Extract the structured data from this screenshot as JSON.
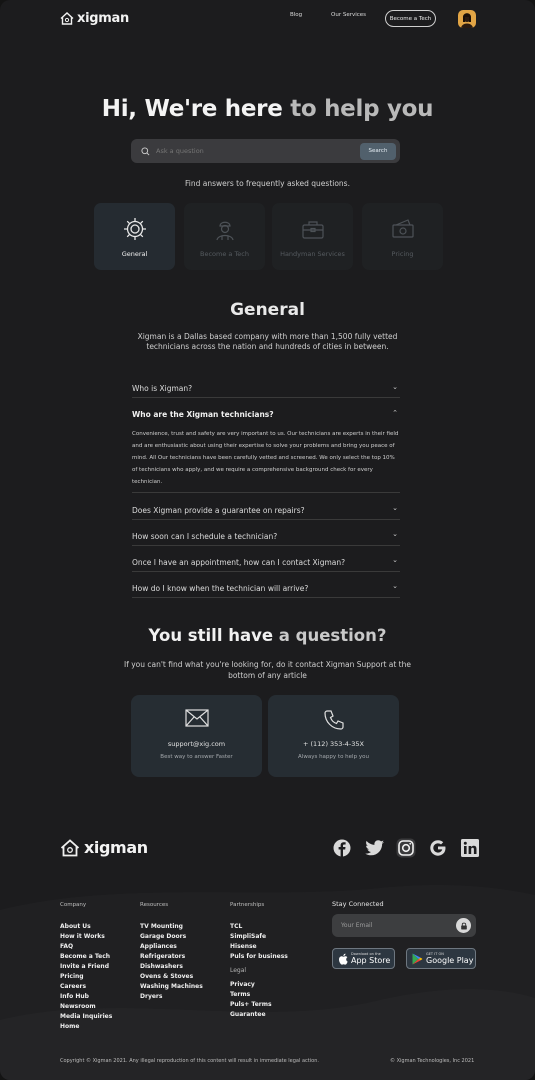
{
  "header": {
    "logo_text": "xigman",
    "nav": {
      "blog": "Blog",
      "services": "Our Services",
      "become": "Become a Tech"
    }
  },
  "hero": {
    "title_main": "Hi, We're here",
    "title_muted": " to help you",
    "search_placeholder": "Ask a question",
    "search_button": "Search",
    "subtitle": "Find answers to frequently asked questions."
  },
  "categories": [
    {
      "label": "General",
      "icon": "gear-icon",
      "active": true
    },
    {
      "label": "Become a Tech",
      "icon": "technician-icon",
      "active": false
    },
    {
      "label": "Handyman Services",
      "icon": "toolbox-icon",
      "active": false
    },
    {
      "label": "Pricing",
      "icon": "money-icon",
      "active": false
    }
  ],
  "general": {
    "title": "General",
    "description": "Xigman is a Dallas based company with more than 1,500 fully vetted technicians across the nation and hundreds of cities in between."
  },
  "faqs": [
    {
      "question": "Who is Xigman?",
      "expanded": false
    },
    {
      "question": "Who are the Xigman technicians?",
      "expanded": true,
      "answer": "Convenience, trust and safety are very important to us. Our technicians are experts in their field and are enthusiastic about using their expertise to solve your problems and bring you peace of mind. All Our technicians have been carefully vetted and screened. We only select the top 10% of technicians who apply, and we require a comprehensive background check for every technician."
    },
    {
      "question": "Does Xigman provide a guarantee on repairs?",
      "expanded": false
    },
    {
      "question": "How soon can I schedule a technician?",
      "expanded": false
    },
    {
      "question": "Once I have an appointment, how can I contact Xigman?",
      "expanded": false
    },
    {
      "question": "How do I know when the technician will arrive?",
      "expanded": false
    }
  ],
  "still": {
    "title_main": "You still have",
    "title_muted": " a question?",
    "description": "If you can't find what you're looking for, do it contact Xigman Support at the bottom of any article"
  },
  "contacts": [
    {
      "icon": "mail-icon",
      "main": "support@xig.com",
      "sub": "Best way to answer Faster"
    },
    {
      "icon": "phone-icon",
      "main": "+ (112) 353-4-35X",
      "sub": "Always happy to help you"
    }
  ],
  "footer": {
    "logo_text": "xigman",
    "socials": [
      "facebook-icon",
      "twitter-icon",
      "instagram-icon",
      "google-icon",
      "linkedin-icon"
    ],
    "company": {
      "title": "Company",
      "items": [
        "About Us",
        "How it Works",
        "FAQ",
        "Become a Tech",
        "Invite a Friend",
        "Pricing",
        "Careers",
        "Info Hub",
        "Newsroom",
        "Media Inquiries",
        "Home"
      ]
    },
    "resources": {
      "title": "Resources",
      "items": [
        "TV Mounting",
        "Garage Doors",
        "Appliances",
        "Refrigerators",
        "Dishwashers",
        "Ovens & Stoves",
        "Washing Machines",
        "Dryers"
      ]
    },
    "partnerships": {
      "title": "Partnerships",
      "items": [
        "TCL",
        "SimpliSafe",
        "Hisense",
        "Puls for business"
      ],
      "legal_title": "Legal",
      "legal": [
        "Privacy",
        "Terms",
        "Puls+ Terms",
        "Guarantee"
      ]
    },
    "stay_connected": "Stay Connected",
    "email_placeholder": "Your Email",
    "app_store": {
      "small": "Download on the",
      "large": "App Store"
    },
    "google_play": {
      "small": "GET IT ON",
      "large": "Google Play"
    },
    "copyright": "Copyright © Xigman 2021. Any illegal reproduction of this content will result in immediate legal action.",
    "company_name": "© Xigman Technologies, Inc 2021"
  }
}
